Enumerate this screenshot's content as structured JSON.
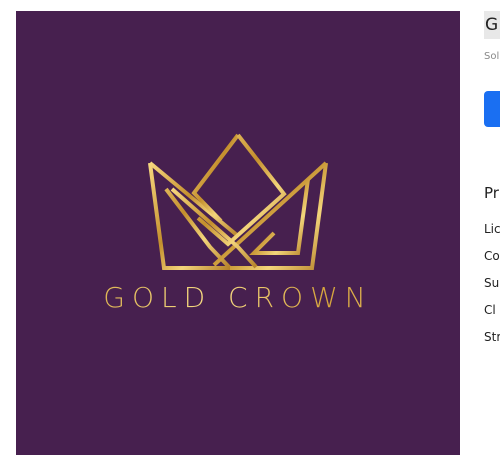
{
  "product": {
    "image_alt": "Gold Crown logo",
    "logo_text": "GOLD CROWN",
    "colors": {
      "background": "#47204f",
      "gold_light": "#f7dc86",
      "gold_dark": "#c9972f",
      "button": "#1a6ff2"
    }
  },
  "details": {
    "title_visible": "G",
    "subtitle_visible": "Sol",
    "button_label": "",
    "section_title_visible": "Pr",
    "properties_visible": [
      "Lic",
      "Co",
      "Su",
      "Cl",
      "Str"
    ]
  }
}
